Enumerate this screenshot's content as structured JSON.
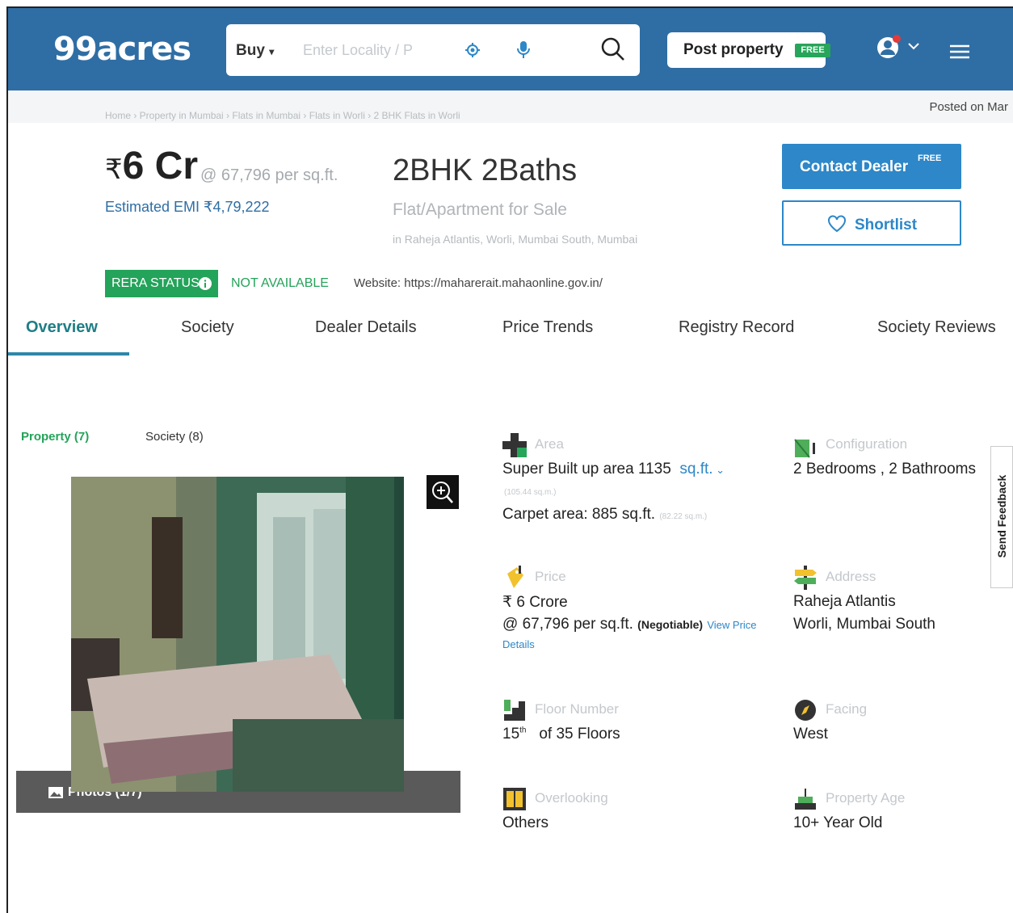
{
  "header": {
    "logo": "99acres",
    "buy_label": "Buy",
    "search_placeholder": "Enter Locality / P",
    "post_label": "Post property",
    "post_badge": "FREE"
  },
  "breadcrumb": {
    "trail": "Home › Property in Mumbai › Flats in Mumbai › Flats in Worli › 2 BHK Flats in Worli",
    "posted_on": "Posted on Mar"
  },
  "listing": {
    "price_symbol": "₹",
    "price": "6 Cr",
    "per_sqft": "@ 67,796 per sq.ft.",
    "emi": "Estimated EMI ₹4,79,222",
    "config": "2BHK 2Baths",
    "type": "Flat/Apartment for Sale",
    "location": "in Raheja Atlantis, Worli, Mumbai South, Mumbai",
    "contact_label": "Contact Dealer",
    "contact_badge": "FREE",
    "shortlist_label": "Shortlist",
    "rera_label": "RERA STATUS",
    "rera_value": "NOT AVAILABLE",
    "website": "Website: https://maharerait.mahaonline.gov.in/"
  },
  "tabs": [
    "Overview",
    "Society",
    "Dealer Details",
    "Price Trends",
    "Registry Record",
    "Society Reviews"
  ],
  "gallery": {
    "property_tab": "Property (7)",
    "society_tab": "Society (8)",
    "photos_label": "Photos (1/7)"
  },
  "details": {
    "area": {
      "label": "Area",
      "value": "Super Built up area 1135",
      "unit": "sq.ft.",
      "sqm": "(105.44 sq.m.)",
      "carpet": "Carpet area: 885 sq.ft.",
      "carpet_sqm": "(82.22 sq.m.)"
    },
    "configuration": {
      "label": "Configuration",
      "value": "2 Bedrooms , 2 Bathrooms"
    },
    "price": {
      "label": "Price",
      "value": "₹ 6 Crore",
      "per": "@ 67,796 per sq.ft.",
      "negotiable": "(Negotiable)",
      "link1": "View Price",
      "link2": "Details"
    },
    "address": {
      "label": "Address",
      "line1": "Raheja Atlantis",
      "line2": "Worli, Mumbai South"
    },
    "floor": {
      "label": "Floor Number",
      "value": "15",
      "suffix": "th",
      "of": "of 35 Floors"
    },
    "facing": {
      "label": "Facing",
      "value": "West"
    },
    "overlooking": {
      "label": "Overlooking",
      "value": "Others"
    },
    "age": {
      "label": "Property Age",
      "value": "10+ Year Old"
    }
  },
  "feedback_label": "Send Feedback",
  "colors": {
    "header": "#2f6ea4",
    "accent_green": "#24a35a",
    "link_blue": "#2d87c8"
  }
}
